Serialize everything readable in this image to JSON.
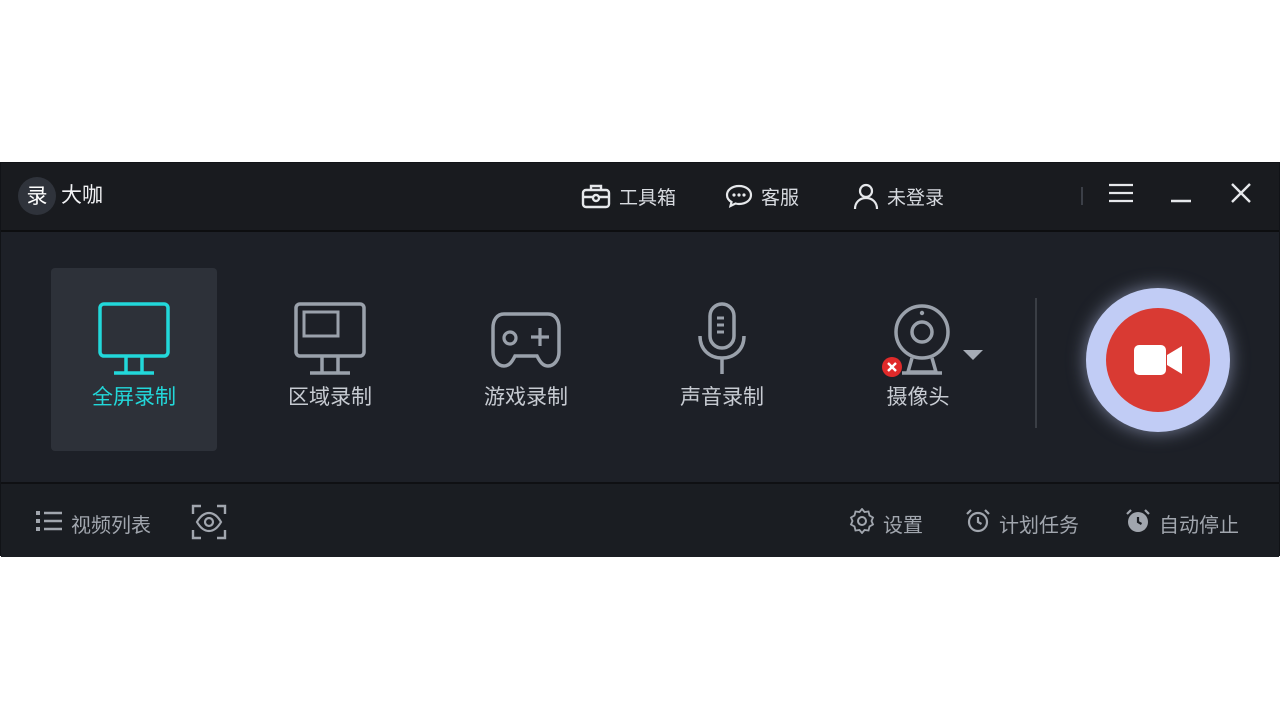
{
  "app": {
    "logo_char": "录",
    "name": "大咖"
  },
  "titlebar": {
    "toolbox_label": "工具箱",
    "service_label": "客服",
    "login_label": "未登录"
  },
  "modes": [
    {
      "label": "全屏录制",
      "icon": "monitor-icon",
      "active": true
    },
    {
      "label": "区域录制",
      "icon": "region-monitor-icon",
      "active": false
    },
    {
      "label": "游戏录制",
      "icon": "gamepad-icon",
      "active": false
    },
    {
      "label": "声音录制",
      "icon": "microphone-icon",
      "active": false
    },
    {
      "label": "摄像头",
      "icon": "webcam-icon",
      "active": false,
      "status": "disconnected"
    }
  ],
  "bottombar": {
    "video_list_label": "视频列表",
    "settings_label": "设置",
    "schedule_label": "计划任务",
    "auto_stop_label": "自动停止"
  },
  "colors": {
    "accent": "#22d8da",
    "record_red": "#d93a33",
    "record_halo": "#c1ccf5",
    "error_red": "#e02a2a"
  }
}
